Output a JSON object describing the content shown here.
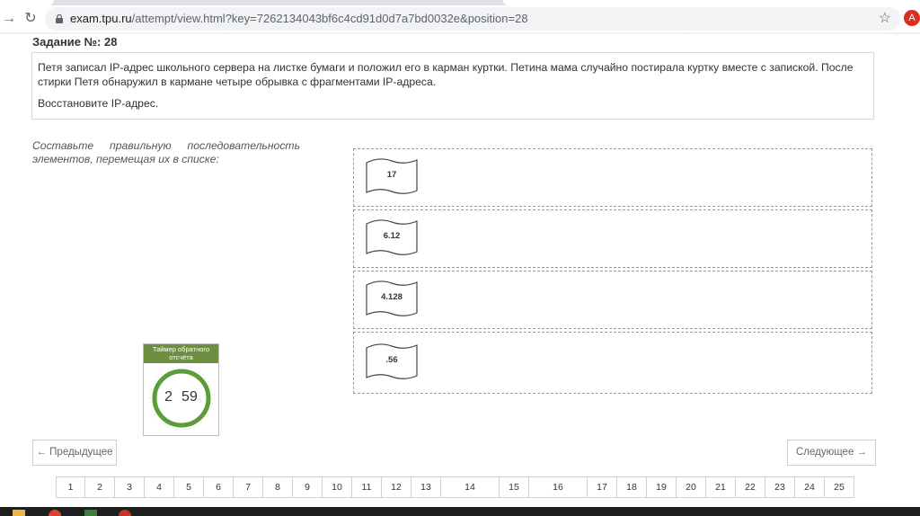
{
  "browser": {
    "url_host": "exam.tpu.ru",
    "url_path": "/attempt/view.html?key=7262134043bf6c4cd91d0d7a7bd0032e&position=28",
    "avatar_letter": "A",
    "accent": "#d93025"
  },
  "task": {
    "title": "Задание №:  28",
    "paragraph1": "Петя записал IP-адрес школьного сервера на листке бумаги и положил его в карман куртки. Петина мама случайно постирала куртку вместе с запиской. После стирки Петя обнаружил в кармане четыре обрывка с фрагментами IP-адреса.",
    "paragraph2": "Восстановите IP-адрес."
  },
  "instruction": "Составьте правильную последовательность элементов, перемещая их в списке:",
  "fragments": [
    "17",
    "6.12",
    "4.128",
    ".56"
  ],
  "timer": {
    "title": "Таймер обратного отсчёта",
    "minutes": "2",
    "seconds": "59",
    "color": "#5a9e3a",
    "header_color": "#6e8f3f"
  },
  "nav": {
    "prev_label": "← Предыдущее",
    "next_label": "Следующее →"
  },
  "pages": [
    "1",
    "2",
    "3",
    "4",
    "5",
    "6",
    "7",
    "8",
    "9",
    "10",
    "11",
    "12",
    "13",
    "14",
    "15",
    "16",
    "17",
    "18",
    "19",
    "20",
    "21",
    "22",
    "23",
    "24",
    "25"
  ]
}
